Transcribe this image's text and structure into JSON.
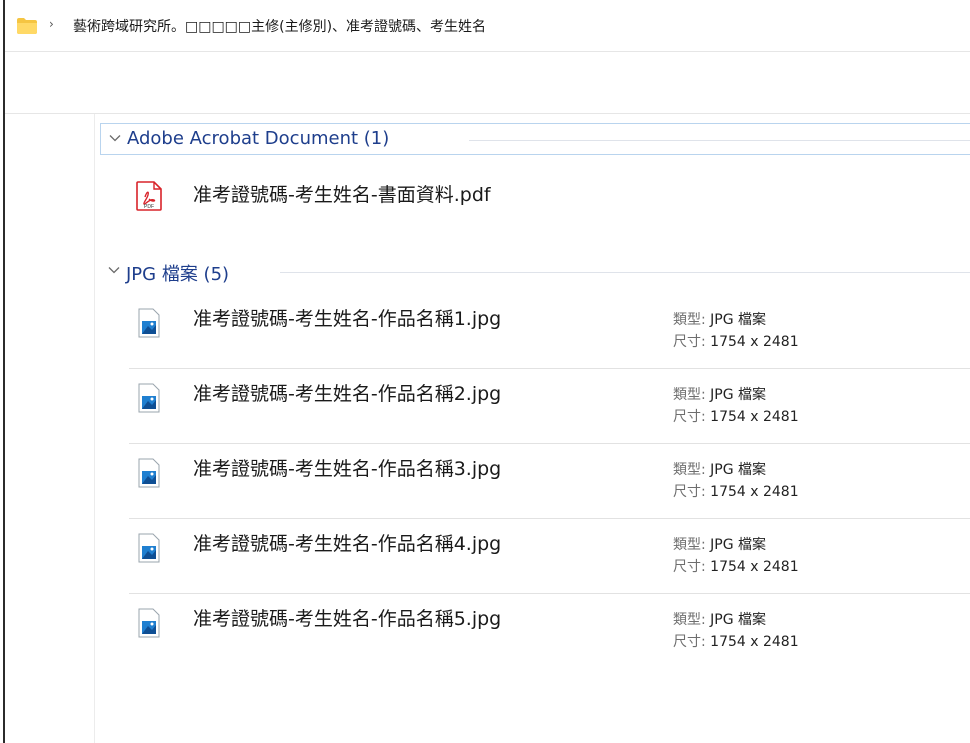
{
  "address_bar": {
    "separator": "›",
    "path": "藝術跨域研究所。□□□□□主修(主修別)、准考證號碼、考生姓名"
  },
  "groups": [
    {
      "title": "Adobe Acrobat Document (1)",
      "files": [
        {
          "name": "准考證號碼-考生姓名-書面資料.pdf",
          "icon": "pdf-file-icon",
          "icon_label": "PDF"
        }
      ]
    },
    {
      "title": "JPG 檔案 (5)",
      "files": [
        {
          "name": "准考證號碼-考生姓名-作品名稱1.jpg",
          "icon": "image-file-icon",
          "type_label": "類型:",
          "type_value": "JPG 檔案",
          "size_label": "尺寸:",
          "size_value": "1754 x 2481"
        },
        {
          "name": "准考證號碼-考生姓名-作品名稱2.jpg",
          "icon": "image-file-icon",
          "type_label": "類型:",
          "type_value": "JPG 檔案",
          "size_label": "尺寸:",
          "size_value": "1754 x 2481"
        },
        {
          "name": "准考證號碼-考生姓名-作品名稱3.jpg",
          "icon": "image-file-icon",
          "type_label": "類型:",
          "type_value": "JPG 檔案",
          "size_label": "尺寸:",
          "size_value": "1754 x 2481"
        },
        {
          "name": "准考證號碼-考生姓名-作品名稱4.jpg",
          "icon": "image-file-icon",
          "type_label": "類型:",
          "type_value": "JPG 檔案",
          "size_label": "尺寸:",
          "size_value": "1754 x 2481"
        },
        {
          "name": "准考證號碼-考生姓名-作品名稱5.jpg",
          "icon": "image-file-icon",
          "type_label": "類型:",
          "type_value": "JPG 檔案",
          "size_label": "尺寸:",
          "size_value": "1754 x 2481"
        }
      ]
    }
  ],
  "colors": {
    "folder": "#f5c542",
    "group_title": "#1e3e8c",
    "pdf_red": "#d8232a",
    "image_blue": "#1f7fd0"
  }
}
